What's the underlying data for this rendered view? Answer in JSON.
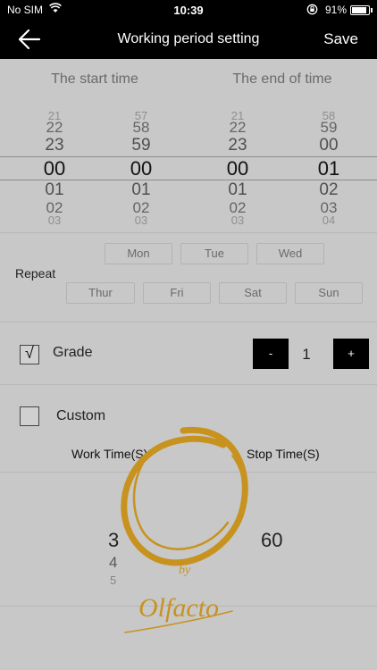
{
  "status_bar": {
    "carrier": "No SIM",
    "time": "10:39",
    "battery_percent": "91%",
    "battery_level": 0.91
  },
  "nav": {
    "title": "Working period setting",
    "save_label": "Save"
  },
  "time_picker": {
    "start_label": "The start time",
    "end_label": "The end of time",
    "columns": [
      {
        "name": "start-hour",
        "rows": [
          "21",
          "22",
          "23",
          "00",
          "01",
          "02",
          "03"
        ]
      },
      {
        "name": "start-minute",
        "rows": [
          "57",
          "58",
          "59",
          "00",
          "01",
          "02",
          "03"
        ]
      },
      {
        "name": "end-hour",
        "rows": [
          "21",
          "22",
          "23",
          "00",
          "01",
          "02",
          "03"
        ]
      },
      {
        "name": "end-minute",
        "rows": [
          "58",
          "59",
          "00",
          "01",
          "02",
          "03",
          "04"
        ]
      }
    ]
  },
  "repeat": {
    "label": "Repeat",
    "days": [
      "Mon",
      "Tue",
      "Wed",
      "Thur",
      "Fri",
      "Sat",
      "Sun"
    ]
  },
  "grade": {
    "label": "Grade",
    "checked": true,
    "check_glyph": "√",
    "minus_label": "-",
    "plus_label": "+",
    "value": "1"
  },
  "custom": {
    "label": "Custom",
    "checked": false,
    "work_time_label": "Work Time(S)",
    "stop_time_label": "Stop Time(S)",
    "work_values": [
      "3",
      "4",
      "5"
    ],
    "stop_value": "60"
  },
  "logo": {
    "by": "by",
    "brand": "Olfacto",
    "color": "#c8921e"
  }
}
